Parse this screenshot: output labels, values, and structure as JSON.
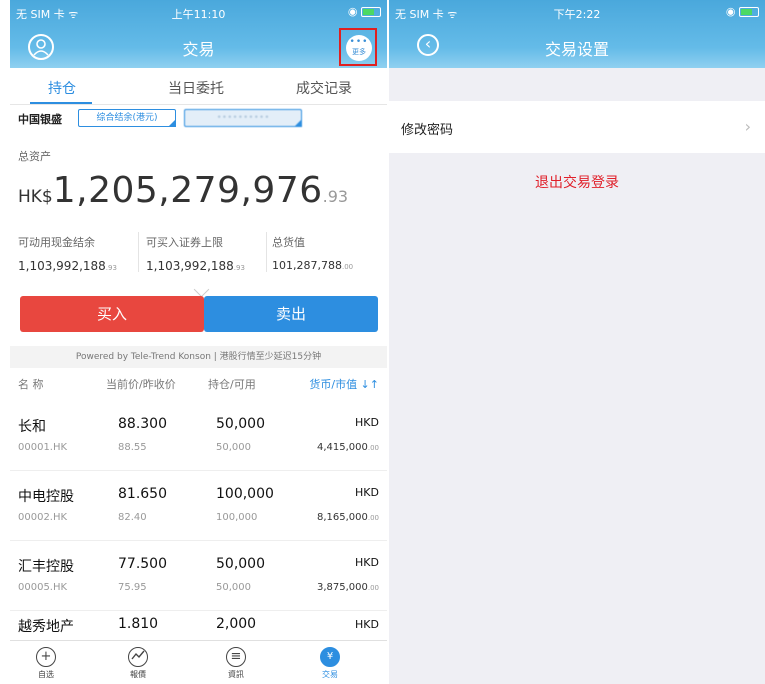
{
  "left": {
    "status": {
      "carrier": "无 SIM 卡 ᯤ",
      "time": "上午11:10",
      "right": "◉"
    },
    "title": "交易",
    "more_label": "更多",
    "tabs": [
      "持仓",
      "当日委托",
      "成交记录"
    ],
    "account": {
      "broker": "中国银盛",
      "type_chip": "综合结余(港元)",
      "account_chip": "••••••••••"
    },
    "total_assets": {
      "label": "总资产",
      "currency": "HK$",
      "amount": "1,205,279,976",
      "decimals": ".93"
    },
    "stats": [
      {
        "label": "可动用现金结余",
        "value": "1,103,992,188",
        "decimals": ".93"
      },
      {
        "label": "可买入证券上限",
        "value": "1,103,992,188",
        "decimals": ".93"
      },
      {
        "label": "总货值",
        "value": "101,287,788",
        "decimals": ".00"
      }
    ],
    "buttons": {
      "buy": "买入",
      "sell": "卖出",
      "buy_color": "#e8473f",
      "sell_color": "#2d8ee0"
    },
    "powered": "Powered by Tele-Trend Konson | 港股行情至少延迟15分钟",
    "table_header": {
      "name": "名 称",
      "price": "当前价/昨收价",
      "position": "持仓/可用",
      "currency": "货币/市值 ↓↑"
    },
    "holdings": [
      {
        "name": "长和",
        "code": "00001.HK",
        "price": "88.300",
        "prev": "88.55",
        "qty": "50,000",
        "avail": "50,000",
        "currency": "HKD",
        "value": "4,415,000",
        "value_dec": ".00"
      },
      {
        "name": "中电控股",
        "code": "00002.HK",
        "price": "81.650",
        "prev": "82.40",
        "qty": "100,000",
        "avail": "100,000",
        "currency": "HKD",
        "value": "8,165,000",
        "value_dec": ".00"
      },
      {
        "name": "汇丰控股",
        "code": "00005.HK",
        "price": "77.500",
        "prev": "75.95",
        "qty": "50,000",
        "avail": "50,000",
        "currency": "HKD",
        "value": "3,875,000",
        "value_dec": ".00"
      },
      {
        "name": "越秀地产",
        "code": "",
        "price": "1.810",
        "prev": "",
        "qty": "2,000",
        "avail": "",
        "currency": "HKD",
        "value": "",
        "value_dec": ""
      }
    ],
    "bottom_tabs": [
      {
        "label": "自选",
        "icon": "plus-circle-icon"
      },
      {
        "label": "報價",
        "icon": "chart-circle-icon"
      },
      {
        "label": "資訊",
        "icon": "news-circle-icon"
      },
      {
        "label": "交易",
        "icon": "trade-circle-icon"
      }
    ],
    "active_bottom_tab": "交易",
    "header_color": "#4aa8dc"
  },
  "right": {
    "status": {
      "carrier": "无 SIM 卡 ᯤ",
      "time": "下午2:22",
      "right": "◉"
    },
    "title": "交易设置",
    "settings": [
      {
        "label": "修改密码"
      }
    ],
    "logout": "退出交易登录",
    "logout_color": "#e0202a"
  }
}
